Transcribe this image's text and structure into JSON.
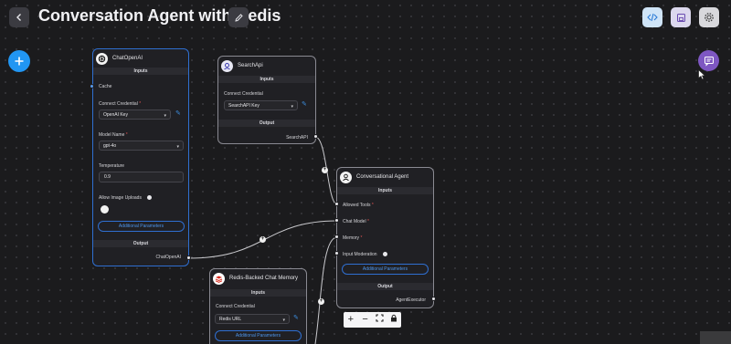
{
  "header": {
    "title": "Conversation Agent with Redis",
    "back_icon": "arrow-left-icon",
    "edit_icon": "pencil-icon",
    "code_icon": "code-icon",
    "save_icon": "save-icon",
    "settings_icon": "gear-icon"
  },
  "colors": {
    "canvas": "#1b1b1d",
    "accent_blue": "#2196f3",
    "chat_purple": "#7e57c2",
    "link_blue": "#4e94e8"
  },
  "nodes": {
    "chat_openai": {
      "title": "ChatOpenAI",
      "inputs_label": "Inputs",
      "cache_label": "Cache",
      "credential_label": "Connect Credential",
      "credential_value": "OpenAI Key",
      "model_label": "Model Name",
      "model_value": "gpt-4o",
      "temperature_label": "Temperature",
      "temperature_value": "0.9",
      "image_uploads_label": "Allow Image Uploads",
      "additional_params": "Additional Parameters",
      "output_label": "Output",
      "output_name": "ChatOpenAI"
    },
    "search_api": {
      "title": "SearchApi",
      "inputs_label": "Inputs",
      "credential_label": "Connect Credential",
      "credential_value": "SearchAPI Key",
      "output_label": "Output",
      "output_name": "SearchAPI"
    },
    "conversational_agent": {
      "title": "Conversational Agent",
      "inputs_label": "Inputs",
      "allowed_tools": "Allowed Tools",
      "chat_model": "Chat Model",
      "memory": "Memory",
      "input_moderation": "Input Moderation",
      "additional_params": "Additional Parameters",
      "output_label": "Output",
      "output_name": "AgentExecutor"
    },
    "redis_memory": {
      "title": "Redis-Backed Chat Memory",
      "inputs_label": "Inputs",
      "credential_label": "Connect Credential",
      "credential_value": "Redis URL",
      "additional_params": "Additional Parameters"
    }
  },
  "zoom_controls": {
    "zoom_in": "+",
    "zoom_out": "−",
    "fit_view": "⛶",
    "lock": "🔒"
  },
  "edge_marker": "+",
  "required_mark": "*",
  "caret": "▾"
}
